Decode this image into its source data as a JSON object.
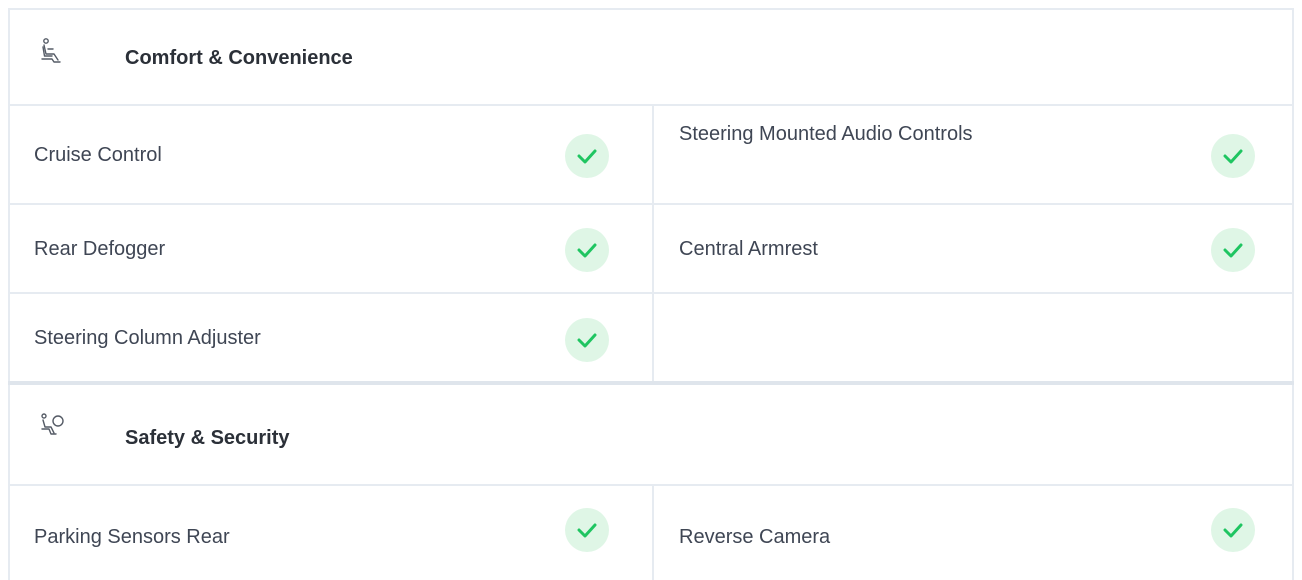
{
  "sections": [
    {
      "title": "Comfort & Convenience",
      "icon": "car-seat-icon",
      "features": [
        {
          "label": "Cruise Control",
          "available": true
        },
        {
          "label": "Steering Mounted Audio Controls",
          "available": true
        },
        {
          "label": "Rear Defogger",
          "available": true
        },
        {
          "label": "Central Armrest",
          "available": true
        },
        {
          "label": "Steering Column Adjuster",
          "available": true
        }
      ]
    },
    {
      "title": "Safety & Security",
      "icon": "airbag-icon",
      "features": [
        {
          "label": "Parking Sensors Rear",
          "available": true
        },
        {
          "label": "Reverse Camera",
          "available": true
        }
      ]
    }
  ],
  "colors": {
    "check_green": "#1fc561",
    "check_bg": "#dff6e6",
    "border": "#e6ebf1",
    "text": "#3f4654"
  }
}
